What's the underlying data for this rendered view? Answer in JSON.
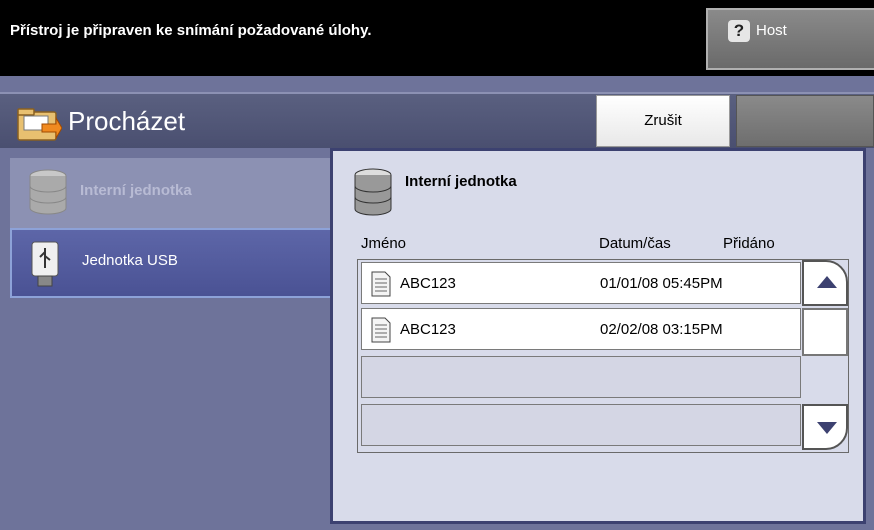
{
  "status": {
    "message": "Přístroj je připraven ke snímání požadované úlohy.",
    "host_label": "Host",
    "help_icon": "help-icon"
  },
  "header": {
    "title": "Procházet",
    "cancel_label": "Zrušit"
  },
  "drives": [
    {
      "label": "Interní jednotka",
      "icon": "database-icon",
      "enabled": false
    },
    {
      "label": "Jednotka USB",
      "icon": "usb-drive-icon",
      "selected": true
    }
  ],
  "panel": {
    "title": "Interní jednotka",
    "columns": [
      "Jméno",
      "Datum/čas",
      "Přidáno"
    ],
    "rows": [
      {
        "name": "ABC123",
        "datetime": "01/01/08 05:45PM",
        "icon": "document-icon"
      },
      {
        "name": "ABC123",
        "datetime": "02/02/08 03:15PM",
        "icon": "document-icon"
      }
    ]
  },
  "colors": {
    "background": "#6e739a",
    "title_bar": "#4a4f70",
    "selected_item": "#4a5294",
    "panel": "#d8dbea"
  }
}
